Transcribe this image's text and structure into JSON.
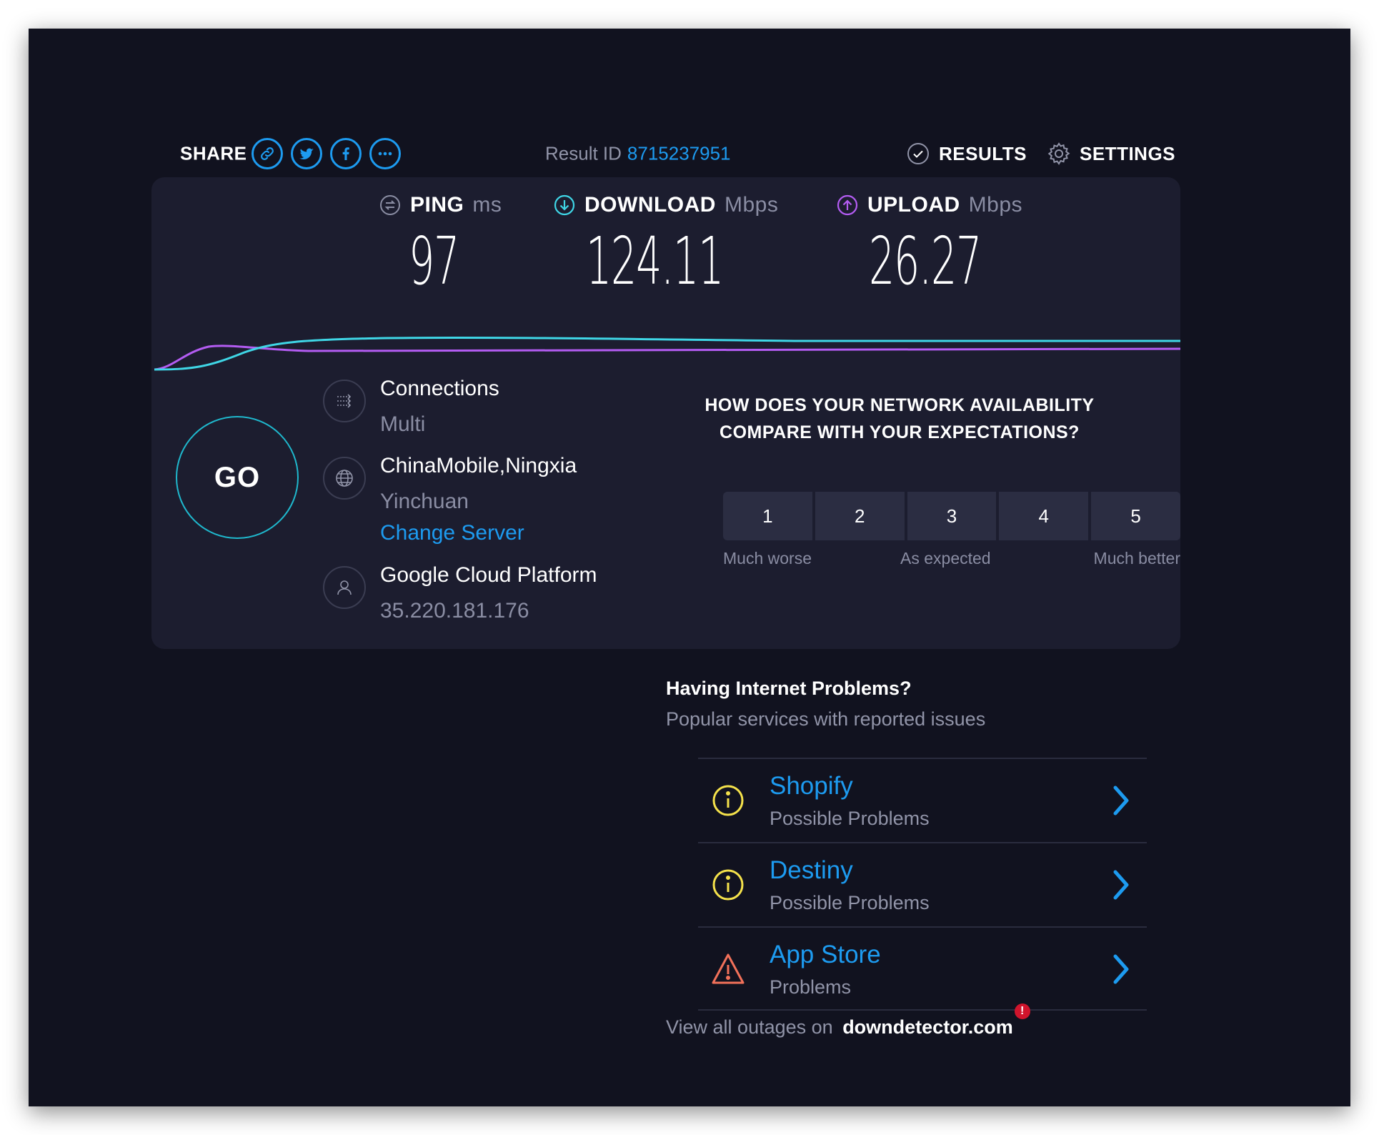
{
  "topbar": {
    "share_label": "SHARE",
    "share_icons": [
      "link-icon",
      "twitter-icon",
      "facebook-icon",
      "more-icon"
    ],
    "result_id_label": "Result ID",
    "result_id": "8715237951",
    "results_label": "RESULTS",
    "settings_label": "SETTINGS"
  },
  "metrics": {
    "ping": {
      "label": "PING",
      "unit": "ms",
      "value": "97"
    },
    "download": {
      "label": "DOWNLOAD",
      "unit": "Mbps",
      "value": "124.11"
    },
    "upload": {
      "label": "UPLOAD",
      "unit": "Mbps",
      "value": "26.27"
    }
  },
  "go_label": "GO",
  "connection": {
    "connections_label": "Connections",
    "connections_value": "Multi",
    "server_name": "ChinaMobile,Ningxia",
    "server_location": "Yinchuan",
    "change_server": "Change Server",
    "host_name": "Google Cloud Platform",
    "host_ip": "35.220.181.176"
  },
  "survey": {
    "question_line1": "HOW DOES YOUR NETWORK AVAILABILITY",
    "question_line2": "COMPARE WITH YOUR EXPECTATIONS?",
    "options": [
      "1",
      "2",
      "3",
      "4",
      "5"
    ],
    "label_worse": "Much worse",
    "label_expected": "As expected",
    "label_better": "Much better"
  },
  "problems": {
    "title": "Having Internet Problems?",
    "subtitle": "Popular services with reported issues",
    "items": [
      {
        "name": "Shopify",
        "status": "Possible Problems",
        "icon": "info-icon"
      },
      {
        "name": "Destiny",
        "status": "Possible Problems",
        "icon": "info-icon"
      },
      {
        "name": "App Store",
        "status": "Problems",
        "icon": "warning-icon"
      }
    ],
    "view_all_prefix": "View all outages on",
    "view_all_site": "downdetector.com",
    "badge": "!"
  },
  "colors": {
    "background": "#11121f",
    "panel": "#1c1d2f",
    "accent_blue": "#1d9bf0",
    "download_line": "#3fd6e6",
    "upload_line": "#b35cf2",
    "info_yellow": "#f5e24b",
    "warning_red": "#f2715a"
  }
}
